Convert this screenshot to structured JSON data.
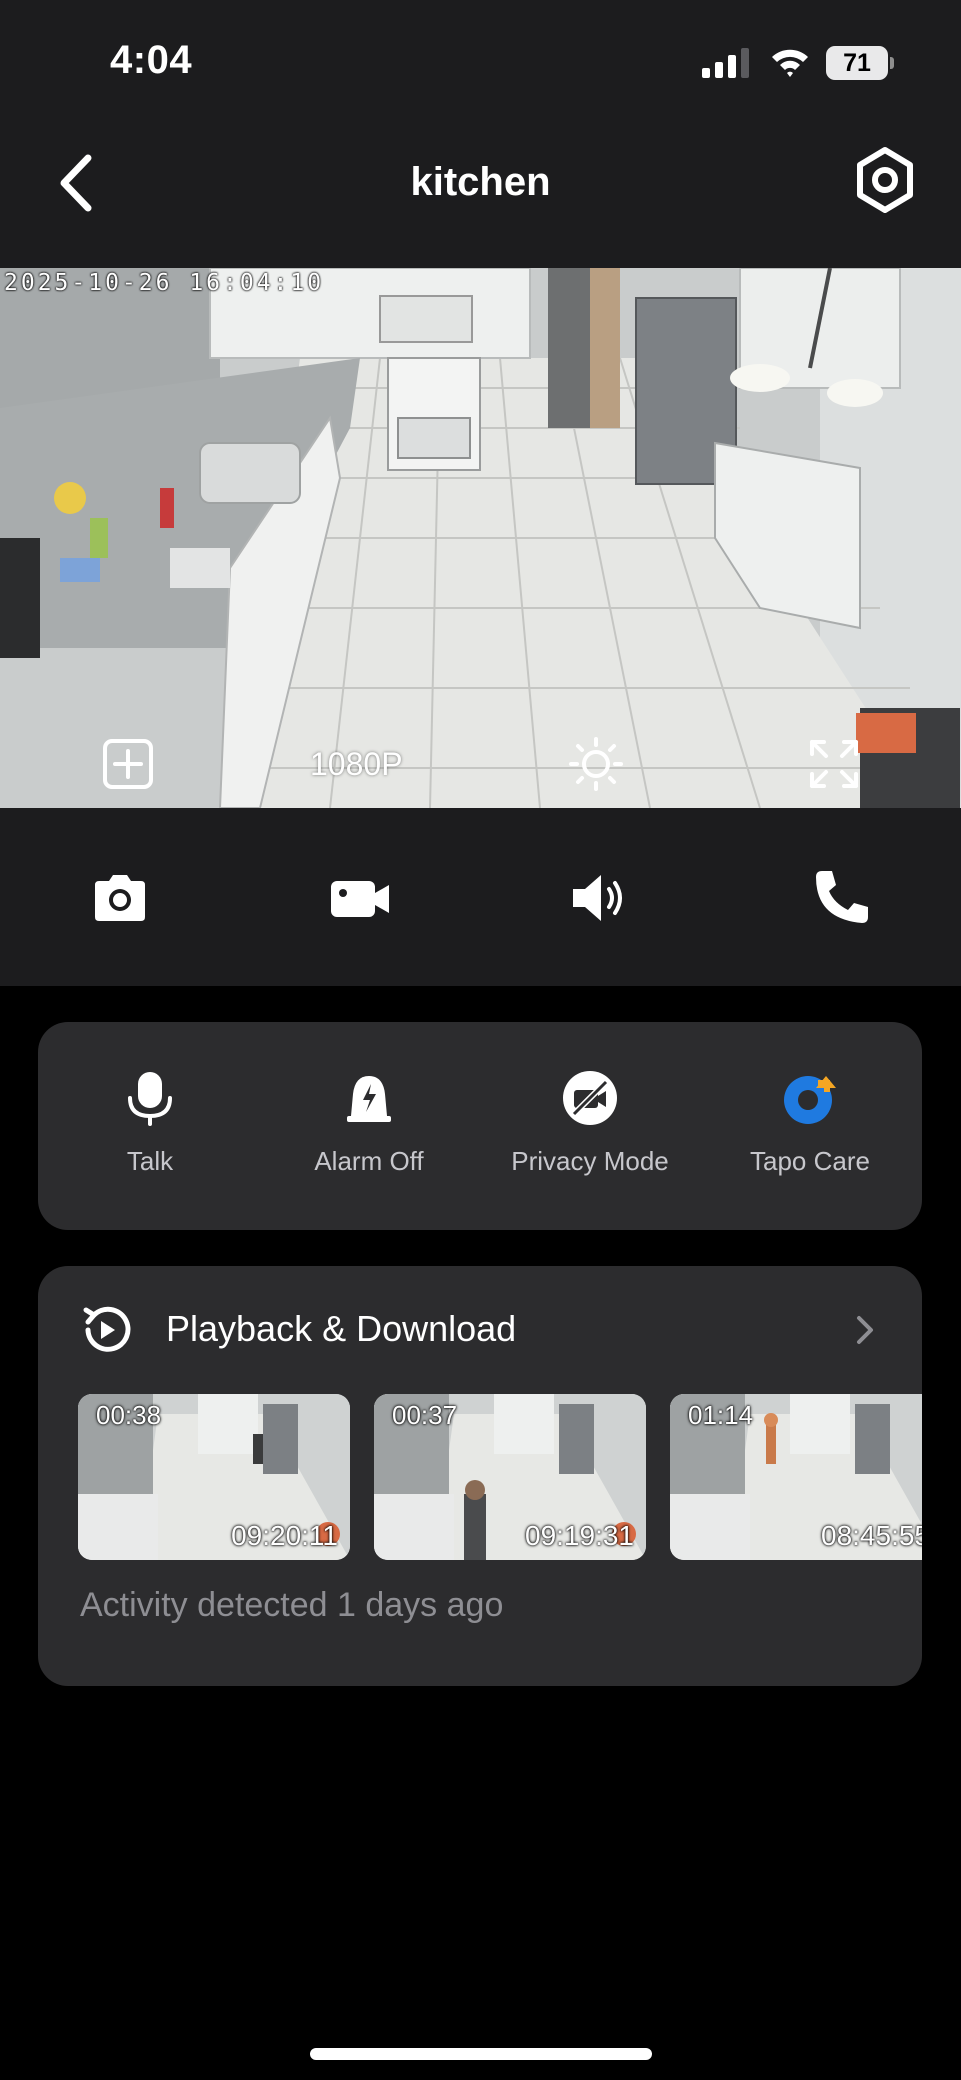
{
  "status_bar": {
    "time": "4:04",
    "battery": "71",
    "icons": [
      "cellular-signal-icon",
      "wifi-icon",
      "battery-icon"
    ]
  },
  "nav": {
    "title": "kitchen",
    "back_icon": "chevron-left-icon",
    "settings_icon": "hexagon-settings-icon"
  },
  "feed": {
    "timestamp": "2025-10-26 16:04:10",
    "resolution": "1080P",
    "controls": [
      "add-view-icon",
      "brightness-icon",
      "fullscreen-icon"
    ]
  },
  "actions": [
    {
      "name": "snapshot",
      "icon": "camera-icon"
    },
    {
      "name": "record",
      "icon": "video-camera-icon"
    },
    {
      "name": "sound",
      "icon": "speaker-icon"
    },
    {
      "name": "call",
      "icon": "phone-icon"
    }
  ],
  "quick_controls": [
    {
      "label": "Talk",
      "icon": "microphone-icon"
    },
    {
      "label": "Alarm Off",
      "icon": "alarm-bell-icon"
    },
    {
      "label": "Privacy Mode",
      "icon": "camera-off-icon"
    },
    {
      "label": "Tapo Care",
      "icon": "tapo-care-icon"
    }
  ],
  "playback": {
    "title": "Playback & Download",
    "clips": [
      {
        "duration": "00:38",
        "time": "09:20:11"
      },
      {
        "duration": "00:37",
        "time": "09:19:31"
      },
      {
        "duration": "01:14",
        "time": "08:45:55"
      }
    ],
    "activity": "Activity detected 1 days ago"
  },
  "colors": {
    "background": "#000000",
    "bar": "#1c1c1e",
    "card": "#2c2c2e",
    "label": "#c7c7cc",
    "muted": "#8e8e93",
    "tapo_blue": "#1f7ae0",
    "tapo_orange": "#f5a623"
  }
}
